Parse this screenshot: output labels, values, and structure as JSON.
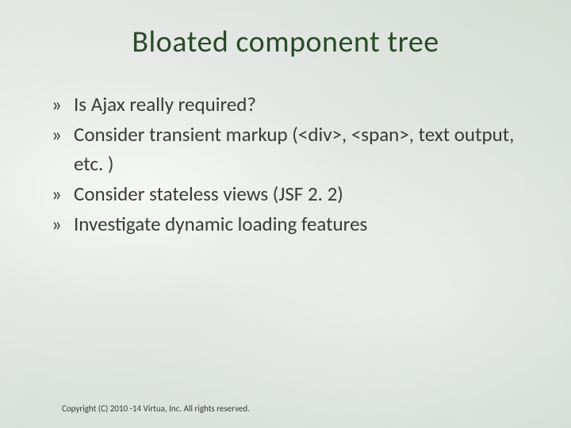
{
  "slide": {
    "title": "Bloated component tree",
    "bullets": [
      "Is Ajax really required?",
      "Consider transient markup (<div>, <span>, text output, etc. )",
      "Consider stateless views (JSF 2. 2)",
      "Investigate dynamic loading features"
    ],
    "copyright": "Copyright (C) 2010 -14 Virtua, Inc. All rights reserved."
  }
}
